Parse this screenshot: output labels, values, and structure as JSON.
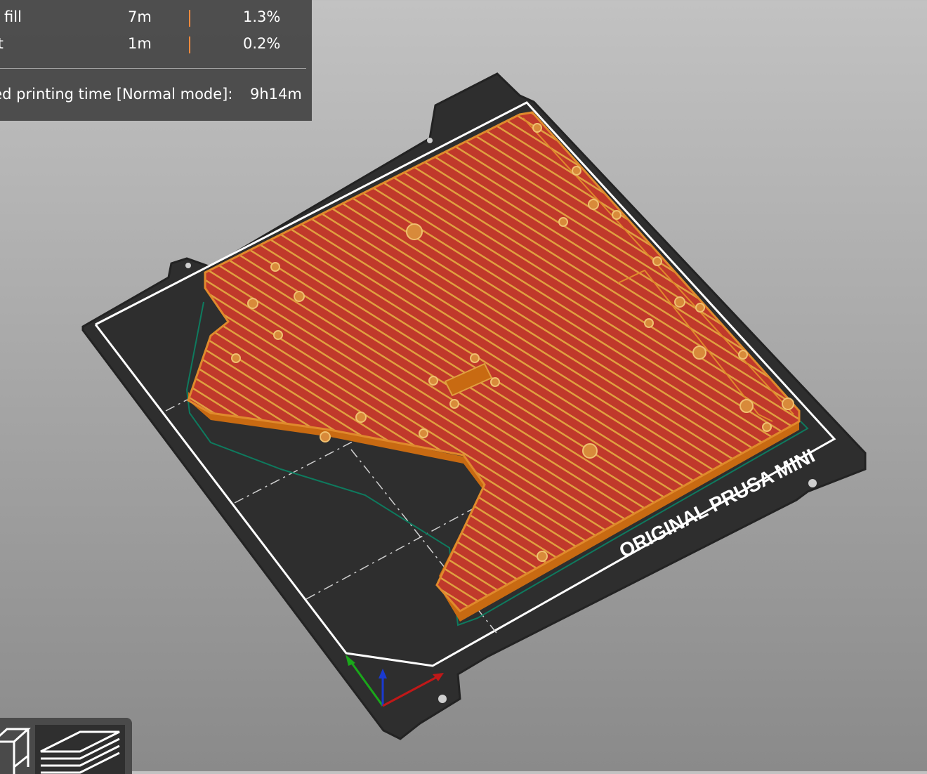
{
  "legend": {
    "rows": [
      {
        "label": "p fill",
        "time": "7m",
        "percent": "1.3%",
        "color": "#ff8a3d"
      },
      {
        "label": "rt",
        "time": "1m",
        "percent": "0.2%",
        "color": "#ff8a3d"
      }
    ],
    "estimated_label": "ted printing time [Normal mode]:",
    "estimated_value": "9h14m"
  },
  "bed": {
    "brand_text": "ORIGINAL PRUSA MINI",
    "plate_color": "#2e2e2e",
    "model_color": "#c0392b",
    "perimeter_color": "#e08a2c"
  },
  "toolbar": {
    "items": [
      {
        "name": "3D view",
        "icon": "cube-icon"
      },
      {
        "name": "Preview",
        "icon": "layers-icon"
      }
    ]
  }
}
